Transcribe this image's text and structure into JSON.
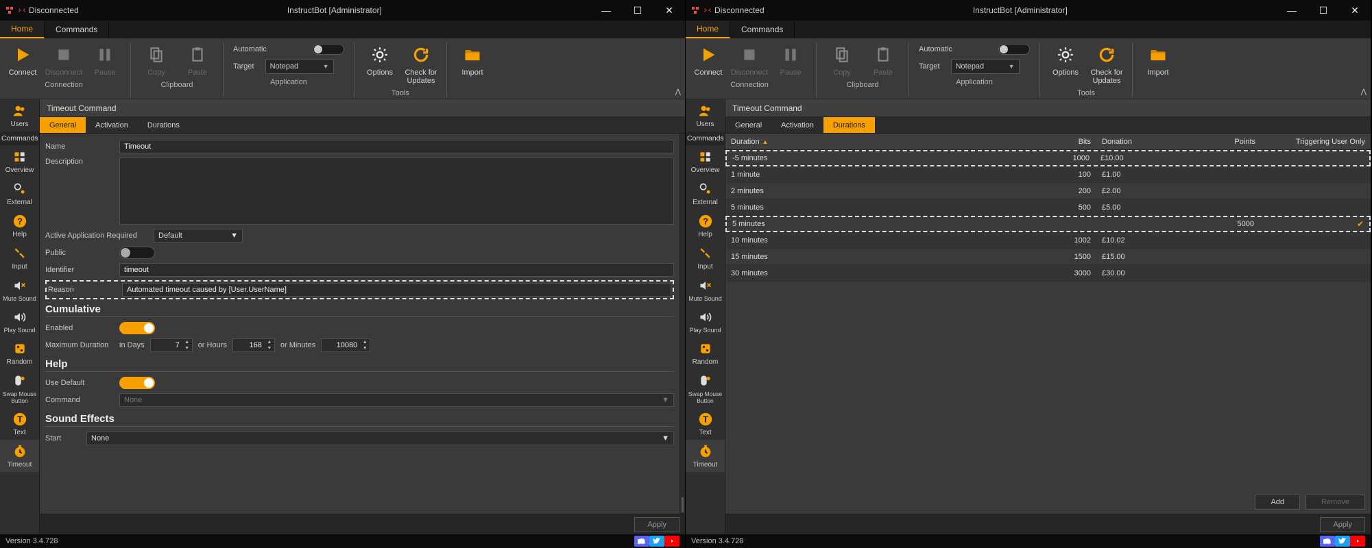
{
  "app": {
    "title": "InstructBot [Administrator]",
    "connection_status": "Disconnected",
    "version": "Version 3.4.728"
  },
  "win_controls": {
    "min": "—",
    "max": "☐",
    "close": "✕"
  },
  "main_tabs": {
    "home": "Home",
    "commands": "Commands"
  },
  "ribbon": {
    "connect": "Connect",
    "disconnect": "Disconnect",
    "pause": "Pause",
    "copy": "Copy",
    "paste": "Paste",
    "automatic": "Automatic",
    "target": "Target",
    "target_value": "Notepad",
    "options": "Options",
    "check_updates": "Check for\nUpdates",
    "import": "Import",
    "group_connection": "Connection",
    "group_clipboard": "Clipboard",
    "group_application": "Application",
    "group_tools": "Tools"
  },
  "sidebar": {
    "sections": {
      "users": "Users",
      "commands": "Commands"
    },
    "items": {
      "overview": "Overview",
      "external": "External",
      "help": "Help",
      "input": "Input",
      "mute": "Mute Sound",
      "play": "Play Sound",
      "random": "Random",
      "swap": "Swap Mouse\nButton",
      "text": "Text",
      "timeout": "Timeout"
    }
  },
  "content": {
    "title": "Timeout Command",
    "tabs": {
      "general": "General",
      "activation": "Activation",
      "durations": "Durations"
    },
    "general": {
      "name_label": "Name",
      "name_value": "Timeout",
      "description_label": "Description",
      "aar_label": "Active Application Required",
      "aar_value": "Default",
      "public_label": "Public",
      "identifier_label": "Identifier",
      "identifier_value": "timeout",
      "reason_label": "Reason",
      "reason_value": "Automated timeout caused by [User.UserName]",
      "cumulative_header": "Cumulative",
      "enabled_label": "Enabled",
      "max_duration_label": "Maximum Duration",
      "in_days": "in Days",
      "days_value": "7",
      "or_hours": "or Hours",
      "hours_value": "168",
      "or_minutes": "or Minutes",
      "minutes_value": "10080",
      "help_header": "Help",
      "use_default_label": "Use Default",
      "command_label": "Command",
      "command_value": "None",
      "sound_effects_header": "Sound Effects",
      "start_label": "Start",
      "start_value": "None",
      "apply": "Apply"
    },
    "durations": {
      "headers": {
        "duration": "Duration",
        "bits": "Bits",
        "donation": "Donation",
        "points": "Points",
        "trigger": "Triggering User Only"
      },
      "rows": [
        {
          "duration": "-5 minutes",
          "bits": "1000",
          "donation": "£10.00",
          "points": "",
          "trigger": "",
          "hl": true
        },
        {
          "duration": "1 minute",
          "bits": "100",
          "donation": "£1.00",
          "points": "",
          "trigger": ""
        },
        {
          "duration": "2 minutes",
          "bits": "200",
          "donation": "£2.00",
          "points": "",
          "trigger": ""
        },
        {
          "duration": "5 minutes",
          "bits": "500",
          "donation": "£5.00",
          "points": "",
          "trigger": ""
        },
        {
          "duration": "5 minutes",
          "bits": "",
          "donation": "",
          "points": "5000",
          "trigger": "✔",
          "hl": true
        },
        {
          "duration": "10 minutes",
          "bits": "1002",
          "donation": "£10.02",
          "points": "",
          "trigger": ""
        },
        {
          "duration": "15 minutes",
          "bits": "1500",
          "donation": "£15.00",
          "points": "",
          "trigger": ""
        },
        {
          "duration": "30 minutes",
          "bits": "3000",
          "donation": "£30.00",
          "points": "",
          "trigger": ""
        }
      ],
      "add": "Add",
      "remove": "Remove",
      "apply": "Apply"
    }
  }
}
